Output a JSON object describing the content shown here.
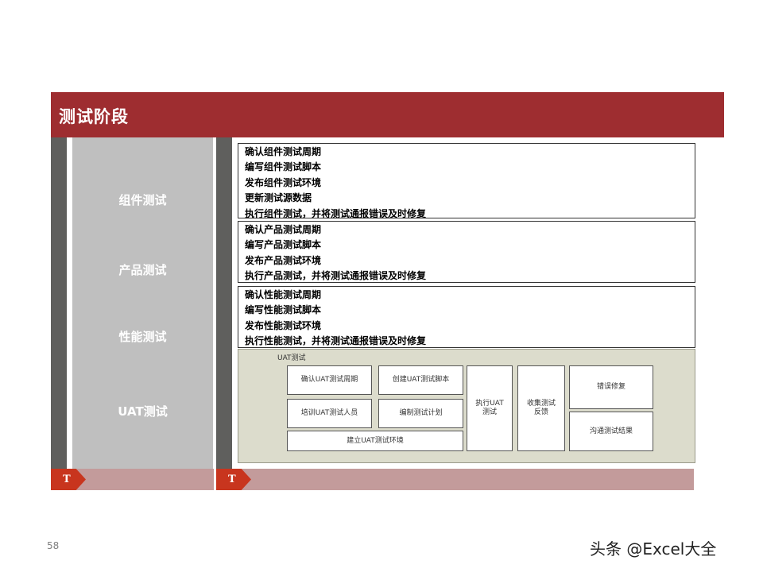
{
  "header": {
    "title": "测试阶段"
  },
  "phases": [
    {
      "label": "组件测试"
    },
    {
      "label": "产品测试"
    },
    {
      "label": "性能测试"
    },
    {
      "label": "UAT测试"
    }
  ],
  "tasks": {
    "component": [
      "确认组件测试周期",
      "编写组件测试脚本",
      "发布组件测试环境",
      "更新测试源数据",
      "执行组件测试，并将测试通报错误及时修复"
    ],
    "product": [
      "确认产品测试周期",
      "编写产品测试脚本",
      "发布产品测试环境",
      "执行产品测试，并将测试通报错误及时修复"
    ],
    "performance": [
      "确认性能测试周期",
      "编写性能测试脚本",
      "发布性能测试环境",
      "执行性能测试，并将测试通报错误及时修复"
    ]
  },
  "uat": {
    "title": "UAT测试",
    "confirm_cycle": "确认UAT测试周期",
    "create_script": "创建UAT测试脚本",
    "train_staff": "培训UAT测试人员",
    "write_plan": "编制测试计划",
    "build_env": "建立UAT测试环境",
    "execute_line1": "执行UAT",
    "execute_line2": "测试",
    "feedback_line1": "收集测试",
    "feedback_line2": "反馈",
    "bug_fix": "错误修复",
    "report_results": "沟通测试结果"
  },
  "markers": {
    "left": "T",
    "right": "T"
  },
  "footer": {
    "page_number": "58",
    "watermark": "头条 @Excel大全"
  },
  "colors": {
    "header": "#9e2d30",
    "strip": "#5f5f5d",
    "phase_bg": "#bfbfbf",
    "bottom_bar": "#c39b9b",
    "marker": "#c8351e",
    "uat_bg": "#dcdccc"
  }
}
